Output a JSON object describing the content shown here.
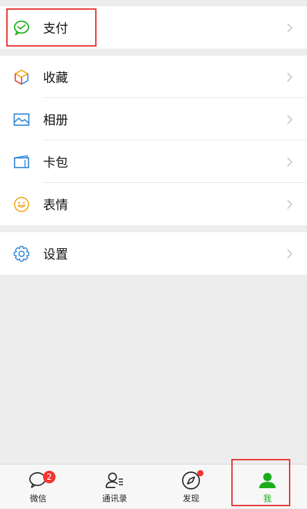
{
  "menu": {
    "pay": {
      "label": "支付",
      "icon": "wechat-pay-icon"
    },
    "favorites": {
      "label": "收藏",
      "icon": "cube-icon"
    },
    "album": {
      "label": "相册",
      "icon": "image-icon"
    },
    "cards": {
      "label": "卡包",
      "icon": "card-icon"
    },
    "stickers": {
      "label": "表情",
      "icon": "smiley-icon"
    },
    "settings": {
      "label": "设置",
      "icon": "gear-icon"
    }
  },
  "tabbar": {
    "chats": {
      "label": "微信",
      "badge": "2"
    },
    "contacts": {
      "label": "通讯录"
    },
    "discover": {
      "label": "发现"
    },
    "me": {
      "label": "我"
    }
  },
  "colors": {
    "accent": "#1aad19",
    "badge": "#f43530",
    "highlight": "#e53935",
    "background": "#ededed"
  }
}
